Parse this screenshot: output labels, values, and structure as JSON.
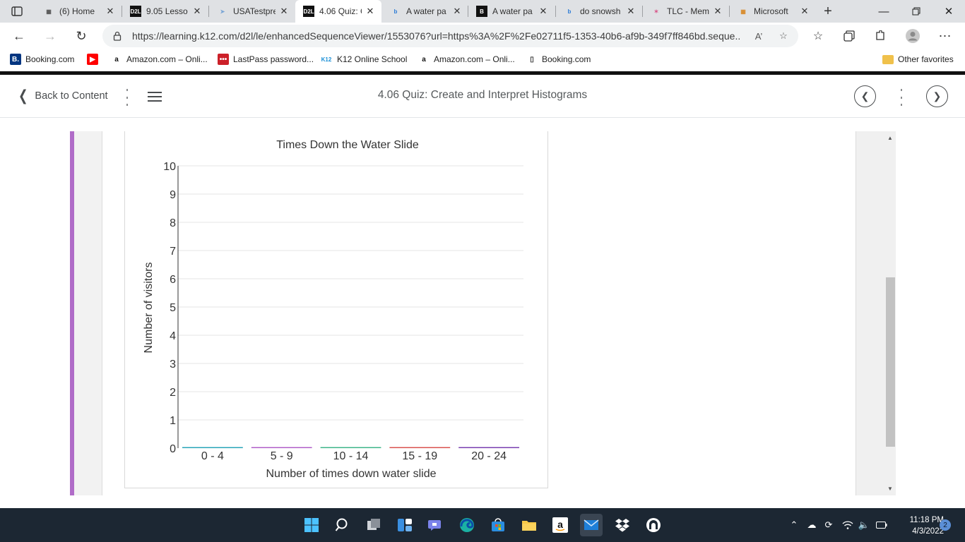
{
  "browser": {
    "tabs": [
      {
        "title": "(6) Home",
        "icon": "gallery-icon"
      },
      {
        "title": "9.05 Lesso",
        "icon": "d2l-icon"
      },
      {
        "title": "USATestpre",
        "icon": "cursor-icon"
      },
      {
        "title": "4.06 Quiz: C",
        "icon": "d2l-icon",
        "active": true
      },
      {
        "title": "A water pa",
        "icon": "bing-icon"
      },
      {
        "title": "A water pa",
        "icon": "brainly-icon"
      },
      {
        "title": "do snowsh",
        "icon": "bing-icon"
      },
      {
        "title": "TLC - Mem",
        "icon": "star-icon"
      },
      {
        "title": "Microsoft",
        "icon": "microsoft-icon"
      }
    ],
    "url": "https://learning.k12.com/d2l/le/enhancedSequenceViewer/1553076?url=https%3A%2F%2Fe02711f5-1353-40b6-af9b-349f7ff846bd.seque...",
    "favorites": [
      {
        "label": "Booking.com",
        "icon": "booking-icon",
        "color": "#003580",
        "glyph": "B."
      },
      {
        "label": "",
        "icon": "youtube-icon",
        "color": "#ff0000",
        "glyph": "▶"
      },
      {
        "label": "Amazon.com – Onli...",
        "icon": "amazon-icon",
        "color": "#ffffff",
        "glyph": "a"
      },
      {
        "label": "LastPass password...",
        "icon": "lastpass-icon",
        "color": "#cc2029",
        "glyph": "•••"
      },
      {
        "label": "K12 Online School",
        "icon": "k12-icon",
        "color": "#ffffff",
        "glyph": "K12"
      },
      {
        "label": "Amazon.com – Onli...",
        "icon": "amazon-icon",
        "color": "#ffffff",
        "glyph": "a"
      },
      {
        "label": "Booking.com",
        "icon": "page-icon",
        "color": "#ffffff",
        "glyph": "▯"
      }
    ],
    "other_favorites": "Other favorites"
  },
  "header": {
    "back_label": "Back to Content",
    "title": "4.06 Quiz: Create and Interpret Histograms"
  },
  "chart_data": {
    "type": "bar",
    "title": "Times Down the Water Slide",
    "xlabel": "Number of times down water slide",
    "ylabel": "Number of visitors",
    "categories": [
      "0 - 4",
      "5 - 9",
      "10 - 14",
      "15 - 19",
      "20 - 24"
    ],
    "values": [
      0,
      0,
      0,
      0,
      0
    ],
    "bar_colors": [
      "#2aa6b8",
      "#b05fc8",
      "#3fb58a",
      "#d9534f",
      "#7a3fb0"
    ],
    "ylim": [
      0,
      10
    ],
    "yticks": [
      0,
      1,
      2,
      3,
      4,
      5,
      6,
      7,
      8,
      9,
      10
    ],
    "grid": true
  },
  "taskbar": {
    "icons": [
      "windows-start-icon",
      "search-icon",
      "task-view-icon",
      "widgets-icon",
      "teams-chat-icon",
      "edge-icon",
      "store-icon",
      "file-explorer-icon",
      "amazon-icon",
      "mail-icon",
      "dropbox-icon",
      "app-icon"
    ],
    "time": "11:18 PM",
    "date": "4/3/2022",
    "notifications": "2"
  }
}
